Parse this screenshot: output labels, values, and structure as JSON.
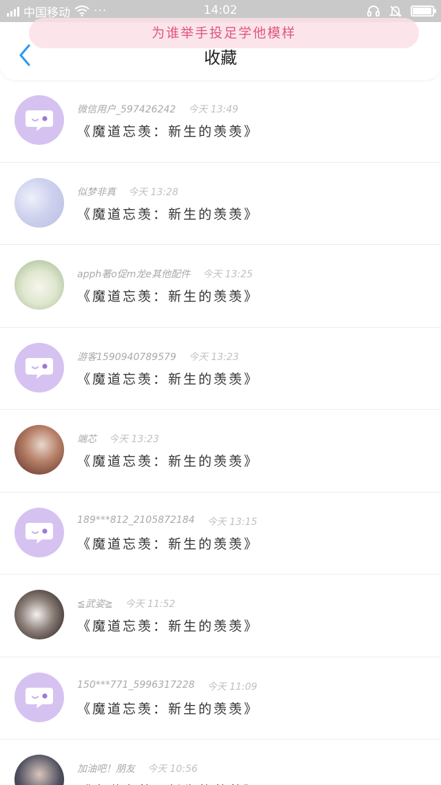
{
  "status_bar": {
    "carrier": "中国移动",
    "dots": "···",
    "time": "14:02",
    "battery_level": 0.95
  },
  "header": {
    "title": "收藏",
    "back_icon": "chevron-left-icon"
  },
  "banner": {
    "text": "为谁举手投足学他模样"
  },
  "colors": {
    "accent": "#2b9cf2",
    "qq_avatar": "#d6c2f1",
    "status_bar": "#c9c9c9",
    "banner_text": "#e1557c"
  },
  "favorites": [
    {
      "user": "微信用户_597426242",
      "time": "今天 13:49",
      "content": "《魔道忘羡：新生的羡羡》",
      "avatar": "qq-default-icon"
    },
    {
      "user": "似梦非真",
      "time": "今天 13:28",
      "content": "《魔道忘羡：新生的羡羡》",
      "avatar": "cloud-avatar"
    },
    {
      "user": "apph著o促m龙e其他配件",
      "time": "今天 13:25",
      "content": "《魔道忘羡：新生的羡羡》",
      "avatar": "lotus-avatar"
    },
    {
      "user": "游客1590940789579",
      "time": "今天 13:23",
      "content": "《魔道忘羡：新生的羡羡》",
      "avatar": "qq-default-icon"
    },
    {
      "user": "端芯",
      "time": "今天 13:23",
      "content": "《魔道忘羡：新生的羡羡》",
      "avatar": "child-photo-avatar"
    },
    {
      "user": "189***812_2105872184",
      "time": "今天 13:15",
      "content": "《魔道忘羡：新生的羡羡》",
      "avatar": "qq-default-icon"
    },
    {
      "user": "≦武姿≧",
      "time": "今天 11:52",
      "content": "《魔道忘羡：新生的羡羡》",
      "avatar": "anime-avatar"
    },
    {
      "user": "150***771_5996317228",
      "time": "今天 11:09",
      "content": "《魔道忘羡：新生的羡羡》",
      "avatar": "qq-default-icon"
    },
    {
      "user": "加油吧！朋友",
      "time": "今天 10:56",
      "content": "《魔道忘羡：新生的羡羡》",
      "avatar": "person-photo-avatar"
    }
  ]
}
